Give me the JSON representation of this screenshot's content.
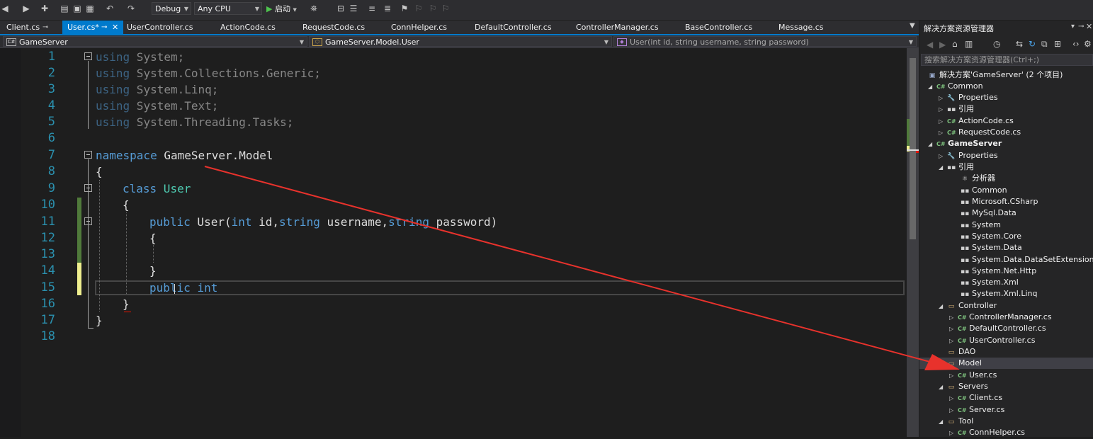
{
  "toolbar": {
    "config": "Debug",
    "platform": "Any CPU",
    "start_label": "启动"
  },
  "tabs": [
    {
      "label": "Client.cs",
      "pinned": true
    },
    {
      "label": "User.cs*",
      "active": true
    },
    {
      "label": "UserController.cs"
    },
    {
      "label": "ActionCode.cs"
    },
    {
      "label": "RequestCode.cs"
    },
    {
      "label": "ConnHelper.cs"
    },
    {
      "label": "DefaultController.cs"
    },
    {
      "label": "ControllerManager.cs"
    },
    {
      "label": "BaseController.cs"
    },
    {
      "label": "Message.cs"
    }
  ],
  "navbar": {
    "project": "GameServer",
    "type": "GameServer.Model.User",
    "member": "User(int id, string username, string password)"
  },
  "editor": {
    "line_numbers": [
      "1",
      "2",
      "3",
      "4",
      "5",
      "6",
      "7",
      "8",
      "9",
      "10",
      "11",
      "12",
      "13",
      "14",
      "15",
      "16",
      "17",
      "18"
    ],
    "lines": [
      {
        "kw": "using",
        "rest": " System;"
      },
      {
        "kw": "using",
        "rest": " System.Collections.Generic;"
      },
      {
        "kw": "using",
        "rest": " System.Linq;"
      },
      {
        "kw": "using",
        "rest": " System.Text;"
      },
      {
        "kw": "using",
        "rest": " System.Threading.Tasks;"
      },
      {
        "kw": "namespace",
        "rest": " GameServer.Model"
      },
      {
        "text": "{"
      },
      {
        "kw": "class",
        "ty": " User"
      },
      {
        "text": "{"
      },
      {
        "kw": "public",
        "rest": " User(",
        "kw2": "int",
        "rest2": " id,",
        "kw3": "string",
        "rest3": " username,",
        "kw4": "string",
        "rest4": " password)"
      },
      {
        "text": "{"
      },
      {
        "text": "}"
      },
      {
        "kw": "public",
        "kw2": "int"
      },
      {
        "text": "}"
      },
      {
        "text": "}"
      }
    ]
  },
  "solution_explorer": {
    "title": "解决方案资源管理器",
    "search_placeholder": "搜索解决方案资源管理器(Ctrl+;)",
    "solution": "解决方案'GameServer' (2 个项目)",
    "items": [
      {
        "label": "Common",
        "icon": "project-icon",
        "bold": false
      },
      {
        "label": "Properties",
        "icon": "wrench-icon"
      },
      {
        "label": "引用",
        "icon": "reference-icon"
      },
      {
        "label": "ActionCode.cs",
        "icon": "csharp-file-icon"
      },
      {
        "label": "RequestCode.cs",
        "icon": "csharp-file-icon"
      },
      {
        "label": "GameServer",
        "icon": "project-icon",
        "bold": true
      },
      {
        "label": "Properties",
        "icon": "wrench-icon"
      },
      {
        "label": "引用",
        "icon": "reference-icon"
      },
      {
        "label": "分析器",
        "icon": "analyzer-icon"
      },
      {
        "label": "Common",
        "icon": "reference-icon"
      },
      {
        "label": "Microsoft.CSharp",
        "icon": "reference-icon"
      },
      {
        "label": "MySql.Data",
        "icon": "reference-icon"
      },
      {
        "label": "System",
        "icon": "reference-icon"
      },
      {
        "label": "System.Core",
        "icon": "reference-icon"
      },
      {
        "label": "System.Data",
        "icon": "reference-icon"
      },
      {
        "label": "System.Data.DataSetExtensions",
        "icon": "reference-icon"
      },
      {
        "label": "System.Net.Http",
        "icon": "reference-icon"
      },
      {
        "label": "System.Xml",
        "icon": "reference-icon"
      },
      {
        "label": "System.Xml.Linq",
        "icon": "reference-icon"
      },
      {
        "label": "Controller",
        "icon": "folder-icon"
      },
      {
        "label": "ControllerManager.cs",
        "icon": "csharp-file-icon"
      },
      {
        "label": "DefaultController.cs",
        "icon": "csharp-file-icon"
      },
      {
        "label": "UserController.cs",
        "icon": "csharp-file-icon"
      },
      {
        "label": "DAO",
        "icon": "folder-icon"
      },
      {
        "label": "Model",
        "icon": "folder-icon",
        "selected": true
      },
      {
        "label": "User.cs",
        "icon": "csharp-file-icon"
      },
      {
        "label": "Servers",
        "icon": "folder-icon"
      },
      {
        "label": "Client.cs",
        "icon": "csharp-file-icon"
      },
      {
        "label": "Server.cs",
        "icon": "csharp-file-icon"
      },
      {
        "label": "Tool",
        "icon": "folder-icon"
      },
      {
        "label": "ConnHelper.cs",
        "icon": "csharp-file-icon"
      }
    ]
  },
  "colors": {
    "accent": "#007acc",
    "annotation_arrow": "#e8322c",
    "keyword": "#569cd6",
    "type": "#4ec9b0",
    "line_number": "#2b91af"
  }
}
